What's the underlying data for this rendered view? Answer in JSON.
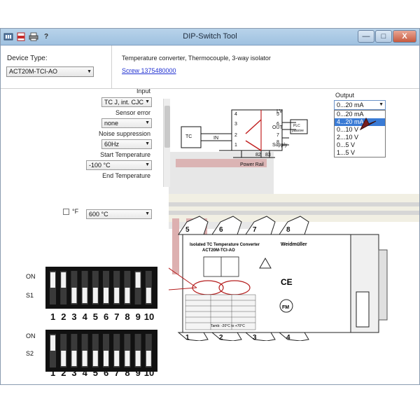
{
  "window": {
    "title": "DIP-Switch Tool",
    "minimize_label": "—",
    "maximize_label": "□",
    "close_label": "X"
  },
  "toolbar": {
    "icon_help_label": "?"
  },
  "device": {
    "label": "Device Type:",
    "selected": "ACT20M-TCI-AO",
    "description": "Temperature converter, Thermocouple, 3-way isolator",
    "link_text": "Screw 1375480000"
  },
  "settings": {
    "input_label": "Input",
    "input_value": "TC J, int. CJC",
    "sensor_error_label": "Sensor error",
    "sensor_error_value": "none",
    "noise_label": "Noise suppression",
    "noise_value": "60Hz",
    "start_label": "Start Temperature",
    "start_value": "-100 °C",
    "end_label": "End Temperature",
    "end_value": "600 °C",
    "fahrenheit_label": "°F"
  },
  "output": {
    "label": "Output",
    "selected": "0...20 mA",
    "options": [
      "0...20 mA",
      "4...20 mA",
      "0...10 V",
      "2...10 V",
      "0...5 V",
      "1...5 V"
    ],
    "highlighted_index": 1
  },
  "wiring": {
    "tc_label": "TC",
    "in_label": "IN",
    "out_label": "OUT",
    "iv_label": "I,V",
    "plc_label": "PLC",
    "passive_label": "passive",
    "supply_label": "Supply",
    "power_rail_label": "Power Rail",
    "terminals_left": [
      "4",
      "3",
      "2",
      "1"
    ],
    "terminals_right": [
      "5",
      "6",
      "7",
      "8"
    ],
    "terminals_bottom": [
      "82",
      "83"
    ],
    "plus": "+",
    "minus": "−"
  },
  "dip": {
    "on_label": "ON",
    "s1_label": "S1",
    "s2_label": "S2",
    "numbers": [
      "1",
      "2",
      "3",
      "4",
      "5",
      "6",
      "7",
      "8",
      "9",
      "10"
    ]
  },
  "device_label": {
    "title_line1": "Isolated TC Temperature Converter",
    "title_line2": "ACT20M-TCI-AO",
    "brand": "Weidmüller",
    "temp_range": "Tamb: -20°C to +70°C",
    "ce_mark": "CE",
    "fm_mark": "FM",
    "module_numbers": [
      "5",
      "6",
      "7",
      "8",
      "1",
      "2",
      "3",
      "4"
    ]
  }
}
